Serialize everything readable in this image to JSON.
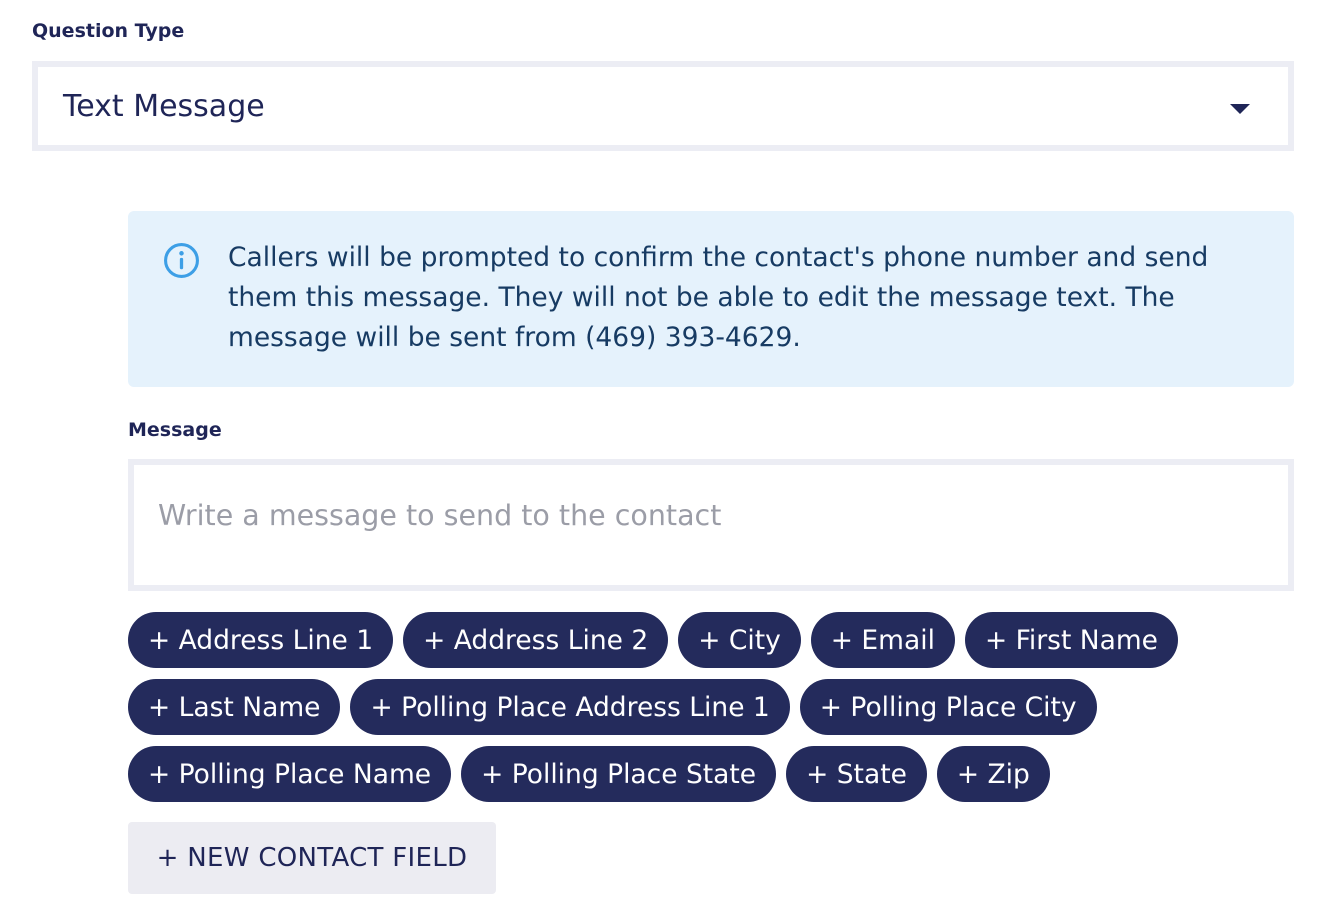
{
  "question_type": {
    "label": "Question Type",
    "selected": "Text Message"
  },
  "info": {
    "icon": "info-icon",
    "accent_color": "#3d9fe6",
    "text": "Callers will be prompted to confirm the contact's phone number and send them this message. They will not be able to edit the message text. The message will be sent from (469) 393-4629."
  },
  "message": {
    "label": "Message",
    "value": "",
    "placeholder": "Write a message to send to the contact"
  },
  "chip_color": "#242b5c",
  "chips": [
    "+ Address Line 1",
    "+ Address Line 2",
    "+ City",
    "+ Email",
    "+ First Name",
    "+ Last Name",
    "+ Polling Place Address Line 1",
    "+ Polling Place City",
    "+ Polling Place Name",
    "+ Polling Place State",
    "+ State",
    "+ Zip"
  ],
  "new_contact_field_label": "+ NEW CONTACT FIELD"
}
